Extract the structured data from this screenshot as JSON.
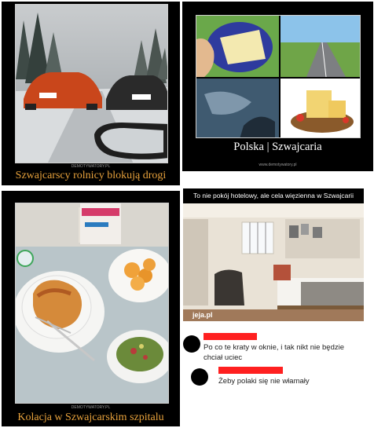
{
  "panels": {
    "p1": {
      "caption": "Szwajcarscy rolnicy blokują drogi",
      "watermark": "DEMOTYWATORY.PL"
    },
    "p2": {
      "caption": "Polska | Szwajcaria",
      "watermark": "www.demotywatory.pl"
    },
    "p3": {
      "caption": "Kolacja w Szwajcarskim szpitalu",
      "watermark": "DEMOTYWATORY.PL"
    },
    "p4": {
      "title": "To nie pokój hotelowy, ale cela więzienna w Szwajcarii",
      "photo_watermark": "jeja.pl",
      "comments": [
        {
          "text": "Po co te kraty w oknie, i tak nikt nie będzie chciał uciec"
        },
        {
          "text": "Żeby polaki się nie włamały"
        }
      ]
    }
  },
  "colors": {
    "caption": "#e8a23c",
    "redacted_name": "#ff2020",
    "panel_bg": "#000000"
  }
}
